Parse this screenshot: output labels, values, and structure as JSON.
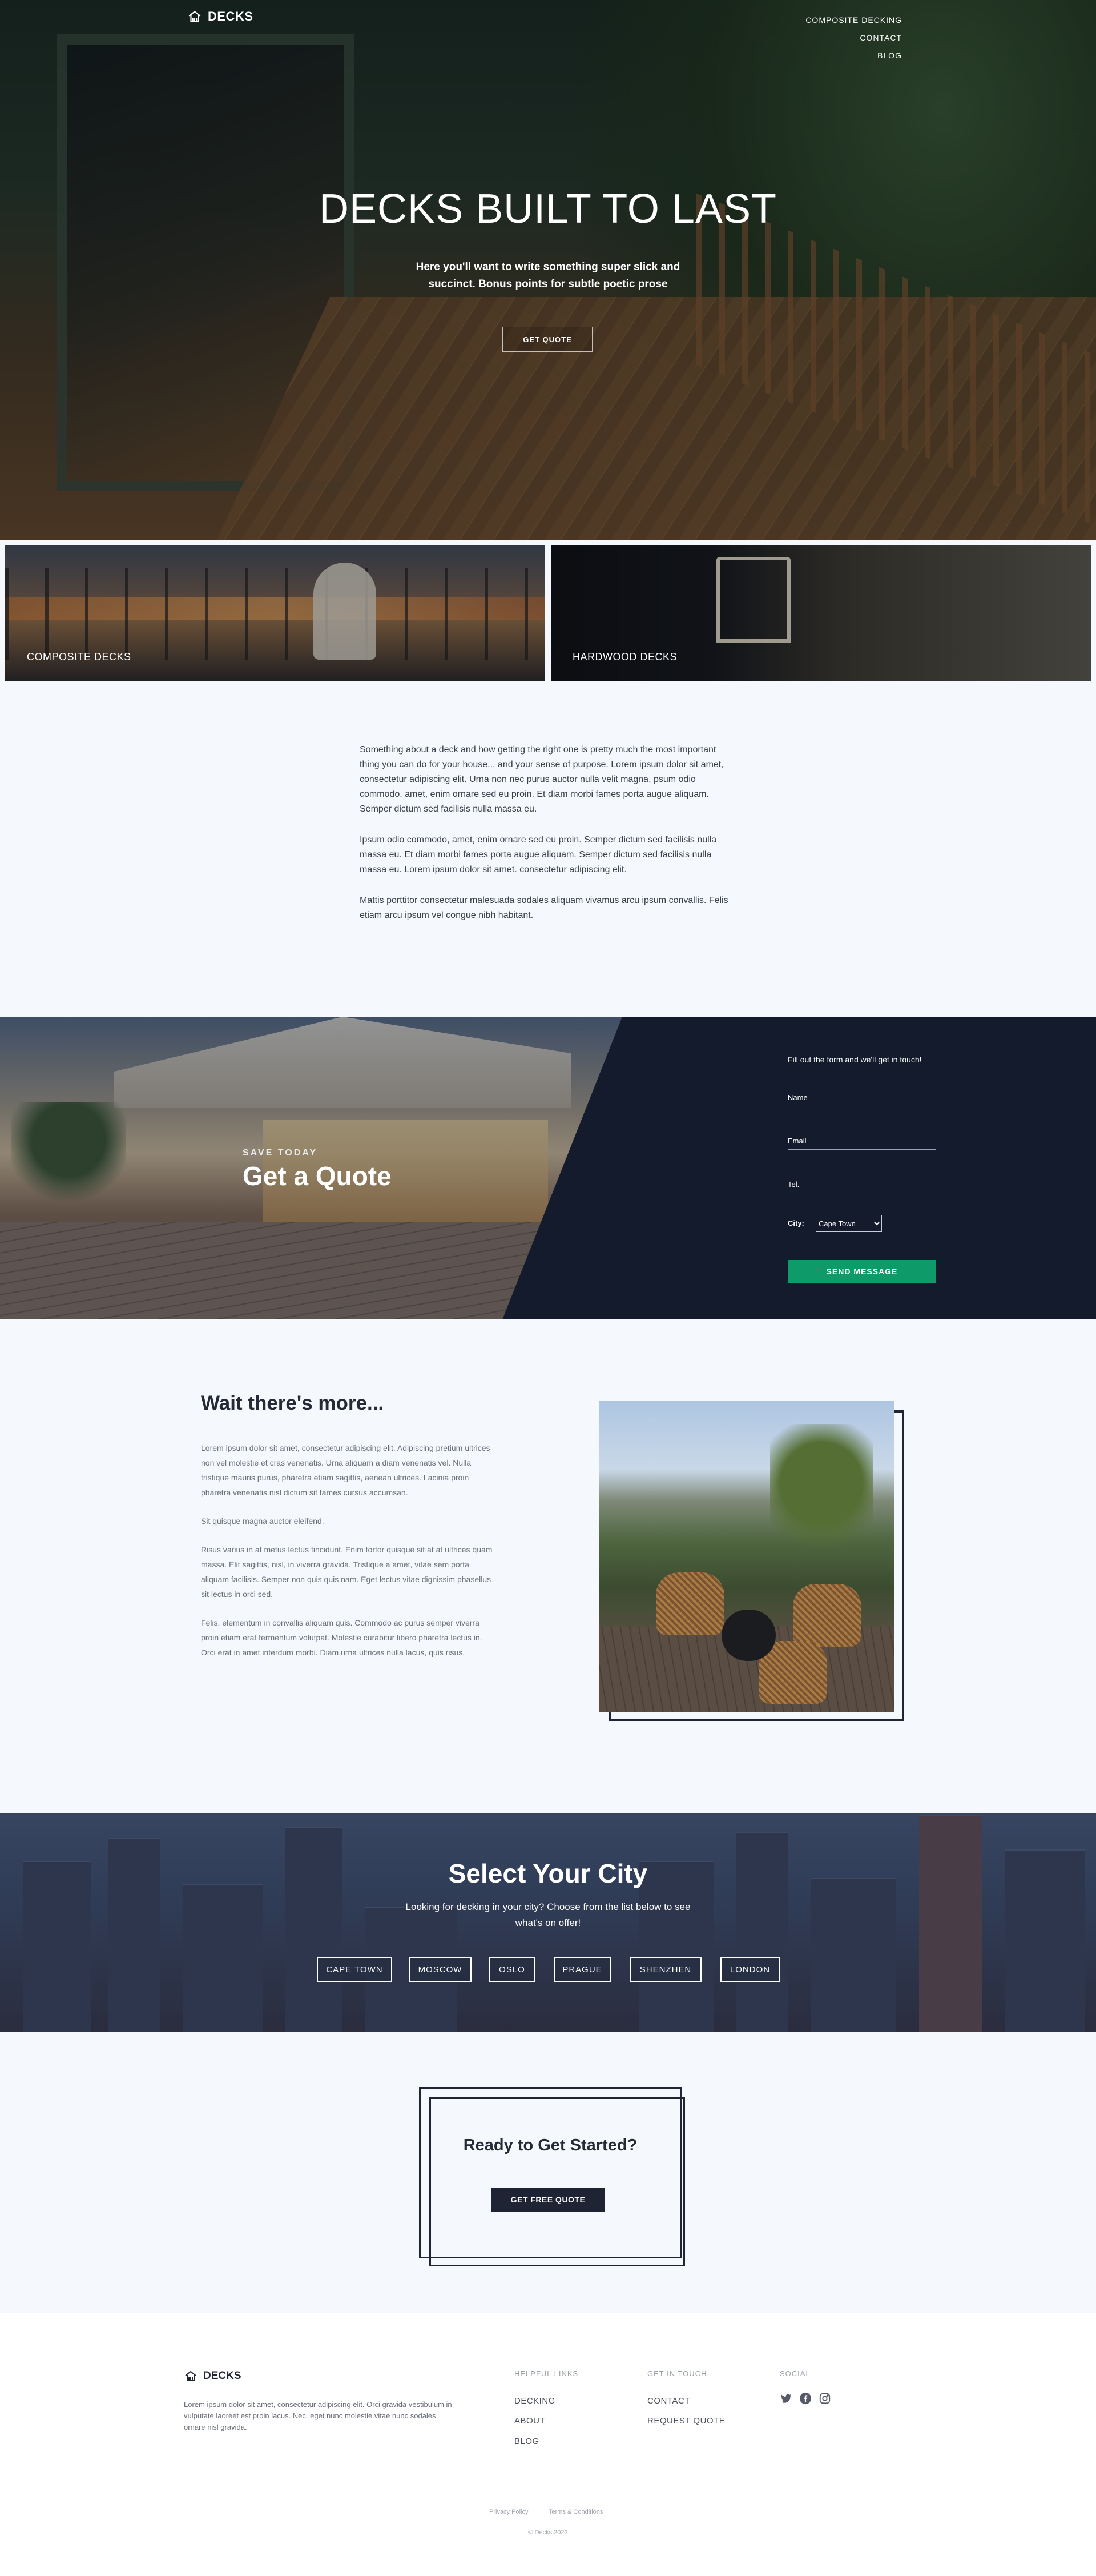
{
  "brand": {
    "name": "DECKS"
  },
  "nav": {
    "items": [
      "COMPOSITE DECKING",
      "CONTACT",
      "BLOG"
    ]
  },
  "hero": {
    "title": "DECKS BUILT TO LAST",
    "subtitle": "Here you'll want to write something super slick and succinct. Bonus points for subtle poetic prose",
    "button": "GET QUOTE"
  },
  "tiles": [
    {
      "label": "COMPOSITE DECKS"
    },
    {
      "label": "HARDWOOD DECKS"
    }
  ],
  "intro": {
    "paragraphs": [
      "Something about a deck and how getting the right one is pretty much the most important thing you can do for your house... and your sense of purpose. Lorem ipsum dolor sit amet, consectetur adipiscing elit. Urna non nec purus auctor nulla velit magna, psum odio commodo. amet, enim ornare sed eu proin. Et diam morbi fames porta augue aliquam. Semper dictum sed facilisis nulla massa eu.",
      "Ipsum odio commodo, amet, enim ornare sed eu proin. Semper dictum sed facilisis nulla massa eu. Et diam morbi fames porta augue aliquam. Semper dictum sed facilisis nulla massa eu. Lorem ipsum dolor sit amet. consectetur adipiscing elit.",
      "Mattis porttitor consectetur malesuada sodales aliquam vivamus arcu ipsum convallis. Felis etiam arcu ipsum vel congue nibh habitant."
    ]
  },
  "quote": {
    "eyebrow": "SAVE TODAY",
    "title": "Get a Quote",
    "form_intro": "Fill out the form and we'll get in touch!",
    "name_placeholder": "Name",
    "email_placeholder": "Email",
    "tel_placeholder": "Tel.",
    "city_label": "City:",
    "city_selected": "Cape Town",
    "submit": "SEND MESSAGE"
  },
  "more": {
    "title": "Wait there's more...",
    "paragraphs": [
      "Lorem ipsum dolor sit amet, consectetur adipiscing elit. Adipiscing pretium ultrices non vel molestie et cras venenatis. Urna aliquam a diam venenatis vel. Nulla tristique mauris purus, pharetra etiam sagittis, aenean ultrices. Lacinia proin pharetra venenatis nisl dictum sit fames cursus accumsan.",
      "Sit quisque magna auctor eleifend.",
      "Risus varius in at metus lectus tincidunt. Enim tortor quisque sit at at ultrices quam massa. Elit sagittis, nisl, in viverra gravida. Tristique a amet, vitae sem porta aliquam facilisis. Semper non quis quis nam. Eget lectus vitae dignissim phasellus sit lectus in orci sed.",
      "Felis, elementum in convallis aliquam quis. Commodo ac purus semper viverra proin etiam erat fermentum volutpat. Molestie curabitur libero pharetra lectus in. Orci erat in amet interdum morbi. Diam urna ultrices nulla lacus, quis risus."
    ]
  },
  "city": {
    "title": "Select Your City",
    "subtitle": "Looking for decking in your city? Choose from the list below to see what's on offer!",
    "buttons": [
      "CAPE TOWN",
      "MOSCOW",
      "OSLO",
      "PRAGUE",
      "SHENZHEN",
      "LONDON"
    ]
  },
  "cta": {
    "title": "Ready to Get Started?",
    "button": "GET FREE QUOTE"
  },
  "footer": {
    "about": "Lorem ipsum dolor sit amet, consectetur adipiscing elit. Orci gravida vestibulum in vulputate laoreet est proin lacus. Nec. eget nunc molestie vitae nunc sodales ornare nisl gravida.",
    "helpful_title": "HELPFUL LINKS",
    "helpful_links": [
      "DECKING",
      "ABOUT",
      "BLOG"
    ],
    "touch_title": "GET IN TOUCH",
    "touch_links": [
      "CONTACT",
      "REQUEST QUOTE"
    ],
    "social_title": "SOCIAL",
    "social_icons": [
      "twitter-icon",
      "facebook-icon",
      "instagram-icon"
    ],
    "privacy": "Privacy Policy",
    "terms": "Terms & Conditions",
    "copyright": "© Decks 2022"
  }
}
